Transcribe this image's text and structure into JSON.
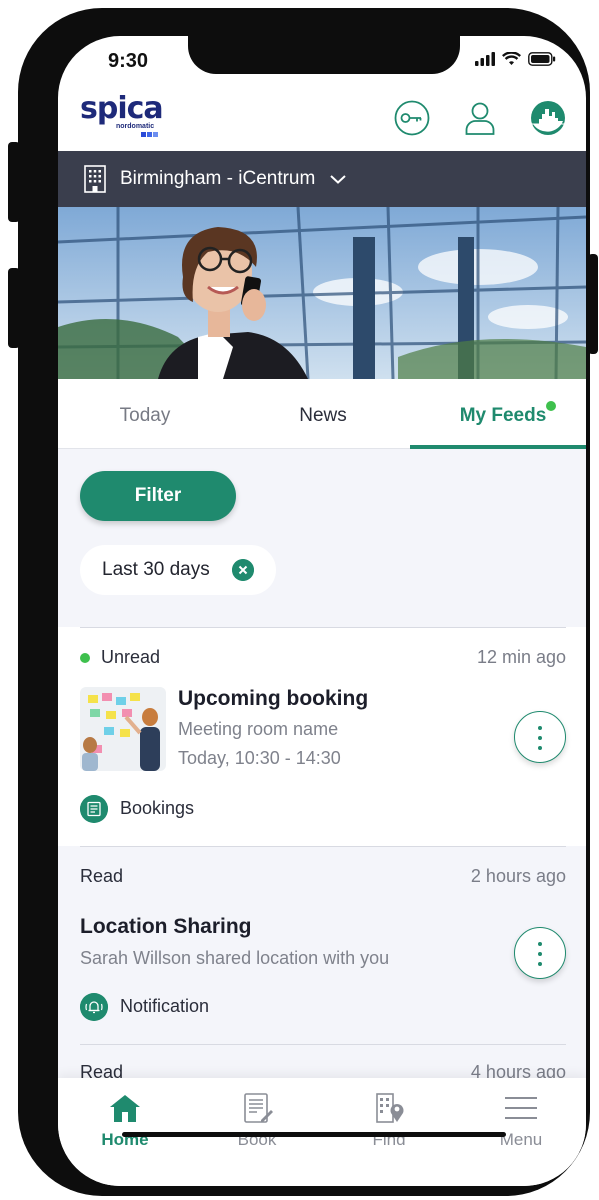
{
  "status_bar": {
    "time": "9:30"
  },
  "header": {
    "logo_text": "spica",
    "logo_subtext": "nordomatic",
    "icons": [
      "key-icon",
      "user-icon",
      "building-avatar-icon"
    ]
  },
  "location": {
    "name": "Birmingham - iCentrum"
  },
  "tabs": [
    {
      "label": "Today",
      "active": false
    },
    {
      "label": "News",
      "active": false
    },
    {
      "label": "My Feeds",
      "active": true,
      "has_dot": true
    }
  ],
  "filter": {
    "button_label": "Filter",
    "chips": [
      {
        "label": "Last 30 days"
      }
    ]
  },
  "feed": [
    {
      "state": "Unread",
      "time_ago": "12 min ago",
      "title": "Upcoming booking",
      "lines": [
        "Meeting room name",
        "Today, 10:30 - 14:30"
      ],
      "category": "Bookings",
      "category_icon": "bookings-icon"
    },
    {
      "state": "Read",
      "time_ago": "2 hours ago",
      "title": "Location Sharing",
      "lines": [
        "Sarah Willson shared location with you"
      ],
      "category": "Notification",
      "category_icon": "notification-icon"
    },
    {
      "state": "Read",
      "time_ago": "4 hours ago"
    }
  ],
  "bottom_nav": [
    {
      "label": "Home",
      "icon": "home-icon",
      "active": true
    },
    {
      "label": "Book",
      "icon": "book-icon",
      "active": false
    },
    {
      "label": "Find",
      "icon": "find-icon",
      "active": false
    },
    {
      "label": "Menu",
      "icon": "menu-icon",
      "active": false
    }
  ],
  "colors": {
    "accent": "#1f8a6e",
    "unread_dot": "#3ec04d",
    "location_bar": "#3a3e4d",
    "logo": "#1e2a7a"
  }
}
